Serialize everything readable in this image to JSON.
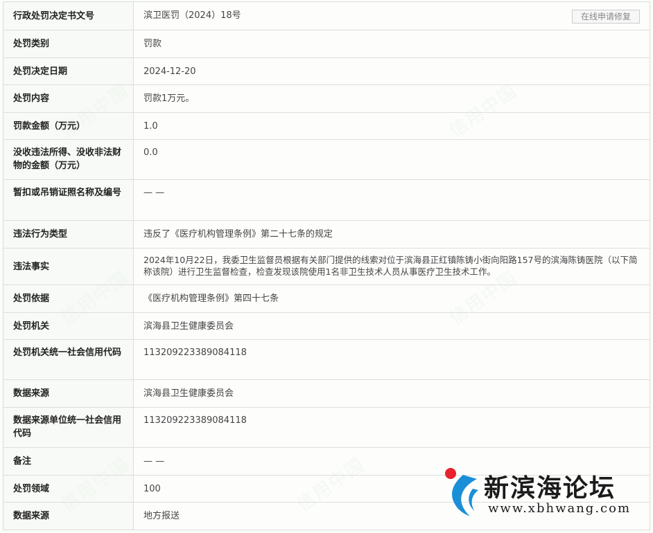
{
  "rows": [
    {
      "label": "行政处罚决定书文号",
      "value": "滨卫医罚（2024）18号"
    },
    {
      "label": "处罚类别",
      "value": "罚款"
    },
    {
      "label": "处罚决定日期",
      "value": "2024-12-20"
    },
    {
      "label": "处罚内容",
      "value": "罚款1万元。"
    },
    {
      "label": "罚款金额（万元）",
      "value": "1.0"
    },
    {
      "label": "没收违法所得、没收非法财物的金额（万元）",
      "value": "0.0"
    },
    {
      "label": "暂扣或吊销证照名称及编号",
      "value": "— —"
    },
    {
      "label": "违法行为类型",
      "value": "违反了《医疗机构管理条例》第二十七条的规定"
    },
    {
      "label": "违法事实",
      "value": "2024年10月22日，我委卫生监督员根据有关部门提供的线索对位于滨海县正红镇陈铸小街向阳路157号的滨海陈铸医院（以下简称该院）进行卫生监督检查，检查发现该院使用1名非卫生技术人员从事医疗卫生技术工作。"
    },
    {
      "label": "处罚依据",
      "value": "《医疗机构管理条例》第四十七条"
    },
    {
      "label": "处罚机关",
      "value": "滨海县卫生健康委员会"
    },
    {
      "label": "处罚机关统一社会信用代码",
      "value": "113209223389084118"
    },
    {
      "label": "数据来源",
      "value": "滨海县卫生健康委员会"
    },
    {
      "label": "数据来源单位统一社会信用代码",
      "value": "113209223389084118"
    },
    {
      "label": "备注",
      "value": "— —"
    },
    {
      "label": "处罚领域",
      "value": "100"
    },
    {
      "label": "数据来源",
      "value": "地方报送"
    }
  ],
  "repair_button_label": "在线申请修复",
  "watermark_text": "信用中国",
  "logo": {
    "title": "新滨海论坛",
    "url": "www.xbhwang.com"
  },
  "colors": {
    "logo_red": "#e8212e",
    "logo_blue": "#1a8fd8",
    "border": "#dddddd"
  }
}
